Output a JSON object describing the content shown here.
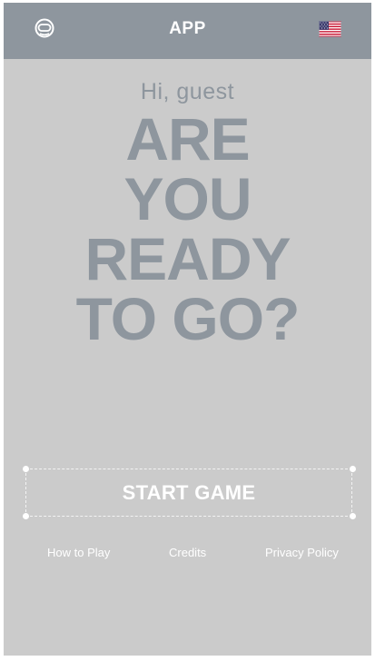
{
  "header": {
    "title": "APP",
    "left_icon": "astronaut-helmet-icon",
    "right_icon": "us-flag-icon"
  },
  "main": {
    "greeting": "Hi, guest",
    "headline_lines": [
      "ARE",
      "YOU",
      "READY",
      "TO GO?"
    ],
    "start_button_label": "START GAME"
  },
  "footer": {
    "links": [
      "How to Play",
      "Credits",
      "Privacy Policy"
    ]
  },
  "colors": {
    "header_bg": "#8e969e",
    "page_bg": "#cbcbcb",
    "headline": "#8e969e",
    "text_light": "#ffffff"
  }
}
